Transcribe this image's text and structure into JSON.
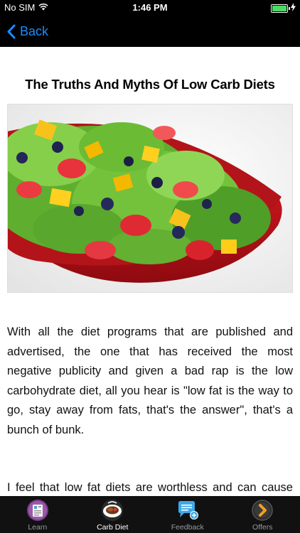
{
  "status": {
    "carrier": "No SIM",
    "time": "1:46 PM",
    "battery_level": 1.0
  },
  "nav": {
    "back_label": "Back"
  },
  "article": {
    "title": "The Truths And Myths Of Low Carb Diets",
    "paragraphs": [
      "With all the diet programs that are published and advertised, the one that has received the most negative publicity and given a bad rap is the low carbohydrate diet, all you hear is \"low fat is the way to go, stay away from fats, that's the answer\", that's a bunch of bunk.",
      "I feel that low fat diets are worthless and can cause more harm than good, some of you may be shocked to read this"
    ]
  },
  "tabs": [
    {
      "label": "Learn",
      "icon": "book-icon",
      "active": false
    },
    {
      "label": "Carb Diet",
      "icon": "plate-icon",
      "active": true
    },
    {
      "label": "Feedback",
      "icon": "chat-bubble-icon",
      "active": false
    },
    {
      "label": "Offers",
      "icon": "chevron-right-icon",
      "active": false
    }
  ],
  "colors": {
    "accent": "#1a8cff",
    "battery": "#4cd964",
    "bowl": "#c0121a"
  }
}
